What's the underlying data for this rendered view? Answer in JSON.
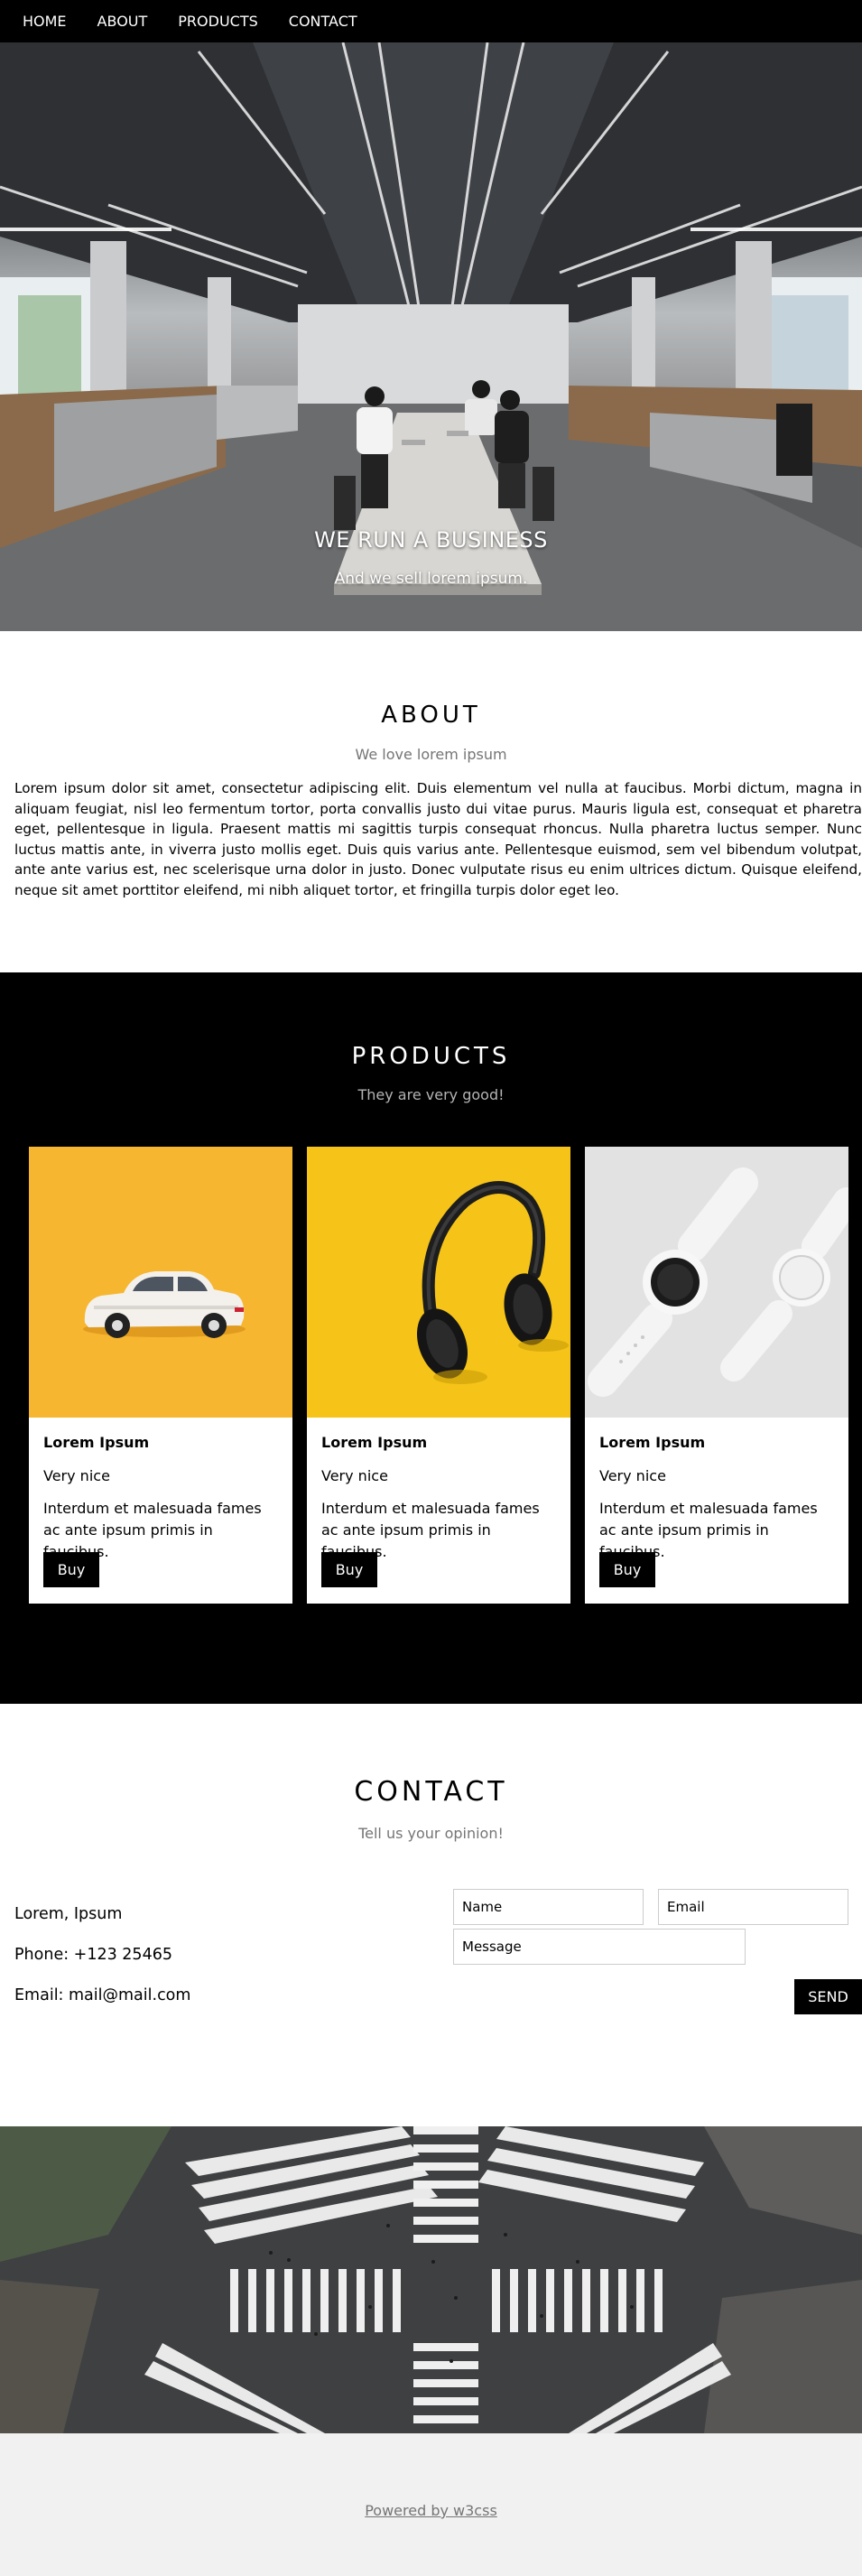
{
  "nav": {
    "items": [
      "HOME",
      "ABOUT",
      "PRODUCTS",
      "CONTACT"
    ]
  },
  "hero": {
    "image_icon": "office-photo",
    "title": "WE RUN A BUSINESS",
    "subtitle": "And we sell lorem ipsum."
  },
  "about": {
    "title": "ABOUT",
    "subtitle": "We love lorem ipsum",
    "text": "Lorem ipsum dolor sit amet, consectetur adipiscing elit. Duis elementum vel nulla at faucibus. Morbi dictum, magna in aliquam feugiat, nisl leo fermentum tortor, porta convallis justo dui vitae purus. Mauris ligula est, consequat et pharetra eget, pellentesque in ligula. Praesent mattis mi sagittis turpis consequat rhoncus. Nulla pharetra luctus semper. Nunc luctus mattis ante, in viverra justo mollis eget. Duis quis varius ante. Pellentesque euismod, sem vel bibendum volutpat, ante ante varius est, nec scelerisque urna dolor in justo. Donec vulputate risus eu enim ultrices dictum. Quisque eleifend, neque sit amet porttitor eleifend, mi nibh aliquet tortor, et fringilla turpis dolor eget leo."
  },
  "products": {
    "title": "PRODUCTS",
    "subtitle": "They are very good!",
    "cards": [
      {
        "image_icon": "toy-car-photo",
        "name": "Lorem Ipsum",
        "tag": "Very nice",
        "desc": "Interdum et malesuada fames ac ante ipsum primis in faucibus.",
        "button": "Buy"
      },
      {
        "image_icon": "headphones-photo",
        "name": "Lorem Ipsum",
        "tag": "Very nice",
        "desc": "Interdum et malesuada fames ac ante ipsum primis in faucibus.",
        "button": "Buy"
      },
      {
        "image_icon": "smartwatch-photo",
        "name": "Lorem Ipsum",
        "tag": "Very nice",
        "desc": "Interdum et malesuada fames ac ante ipsum primis in faucibus.",
        "button": "Buy"
      }
    ]
  },
  "contact": {
    "title": "CONTACT",
    "subtitle": "Tell us your opinion!",
    "name_line": "Lorem, Ipsum",
    "phone_line": "Phone: +123 25465",
    "email_line": "Email: mail@mail.com",
    "name_placeholder": "Name",
    "email_placeholder": "Email",
    "message_placeholder": "Message",
    "send_label": "SEND"
  },
  "crossing": {
    "image_icon": "street-crossing-photo"
  },
  "footer": {
    "link": "Powered by w3css"
  },
  "colors": {
    "nav_bg": "#000000",
    "products_bg": "#000000",
    "footer_bg": "#f1f1f1",
    "muted_text": "#757575",
    "car_card_bg": "#f7b52c",
    "headphones_card_bg": "#f5c213",
    "watch_card_bg": "#e3e3e3"
  }
}
